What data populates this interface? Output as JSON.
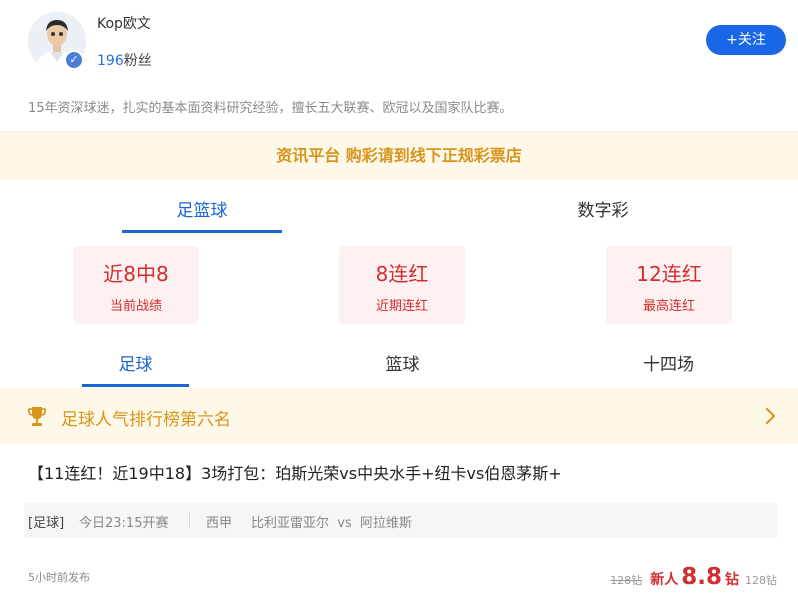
{
  "header": {
    "author_name": "Kop欧文",
    "fans_count": "196",
    "fans_label": "粉丝",
    "follow_label": "+关注",
    "bio": "15年资深球迷，扎实的基本面资料研究经验，擅长五大联赛、欧冠以及国家队比赛。"
  },
  "notice": "资讯平台 购彩请到线下正规彩票店",
  "main_tabs": [
    {
      "label": "足篮球",
      "active": true
    },
    {
      "label": "数字彩",
      "active": false
    }
  ],
  "stats": [
    {
      "value": "近8中8",
      "label": "当前战绩"
    },
    {
      "value": "8连红",
      "label": "近期连红"
    },
    {
      "value": "12连红",
      "label": "最高连红"
    }
  ],
  "sub_tabs": [
    {
      "label": "足球",
      "active": true
    },
    {
      "label": "篮球",
      "active": false
    },
    {
      "label": "十四场",
      "active": false
    }
  ],
  "rank": {
    "text": "足球人气排行榜第六名",
    "icon": "trophy-icon",
    "chevron": "chevron-right-icon"
  },
  "article": {
    "title": "【11连红！近19中18】3场打包：珀斯光荣vs中央水手+纽卡vs伯恩茅斯+",
    "match": {
      "tag": "[足球]",
      "time": "今日23:15开赛",
      "league": "西甲",
      "teams": "比利亚雷亚尔  vs  阿拉维斯"
    },
    "posted": "5小时前发布",
    "price": {
      "old": "128钻",
      "new_label": "新人",
      "new_value": "8.8",
      "unit": "钻",
      "original": "128钻"
    }
  },
  "colors": {
    "accent_blue": "#1a66d0",
    "red": "#d12f2f",
    "gold": "#d8941c",
    "notice_bg": "#fdf8e8"
  }
}
